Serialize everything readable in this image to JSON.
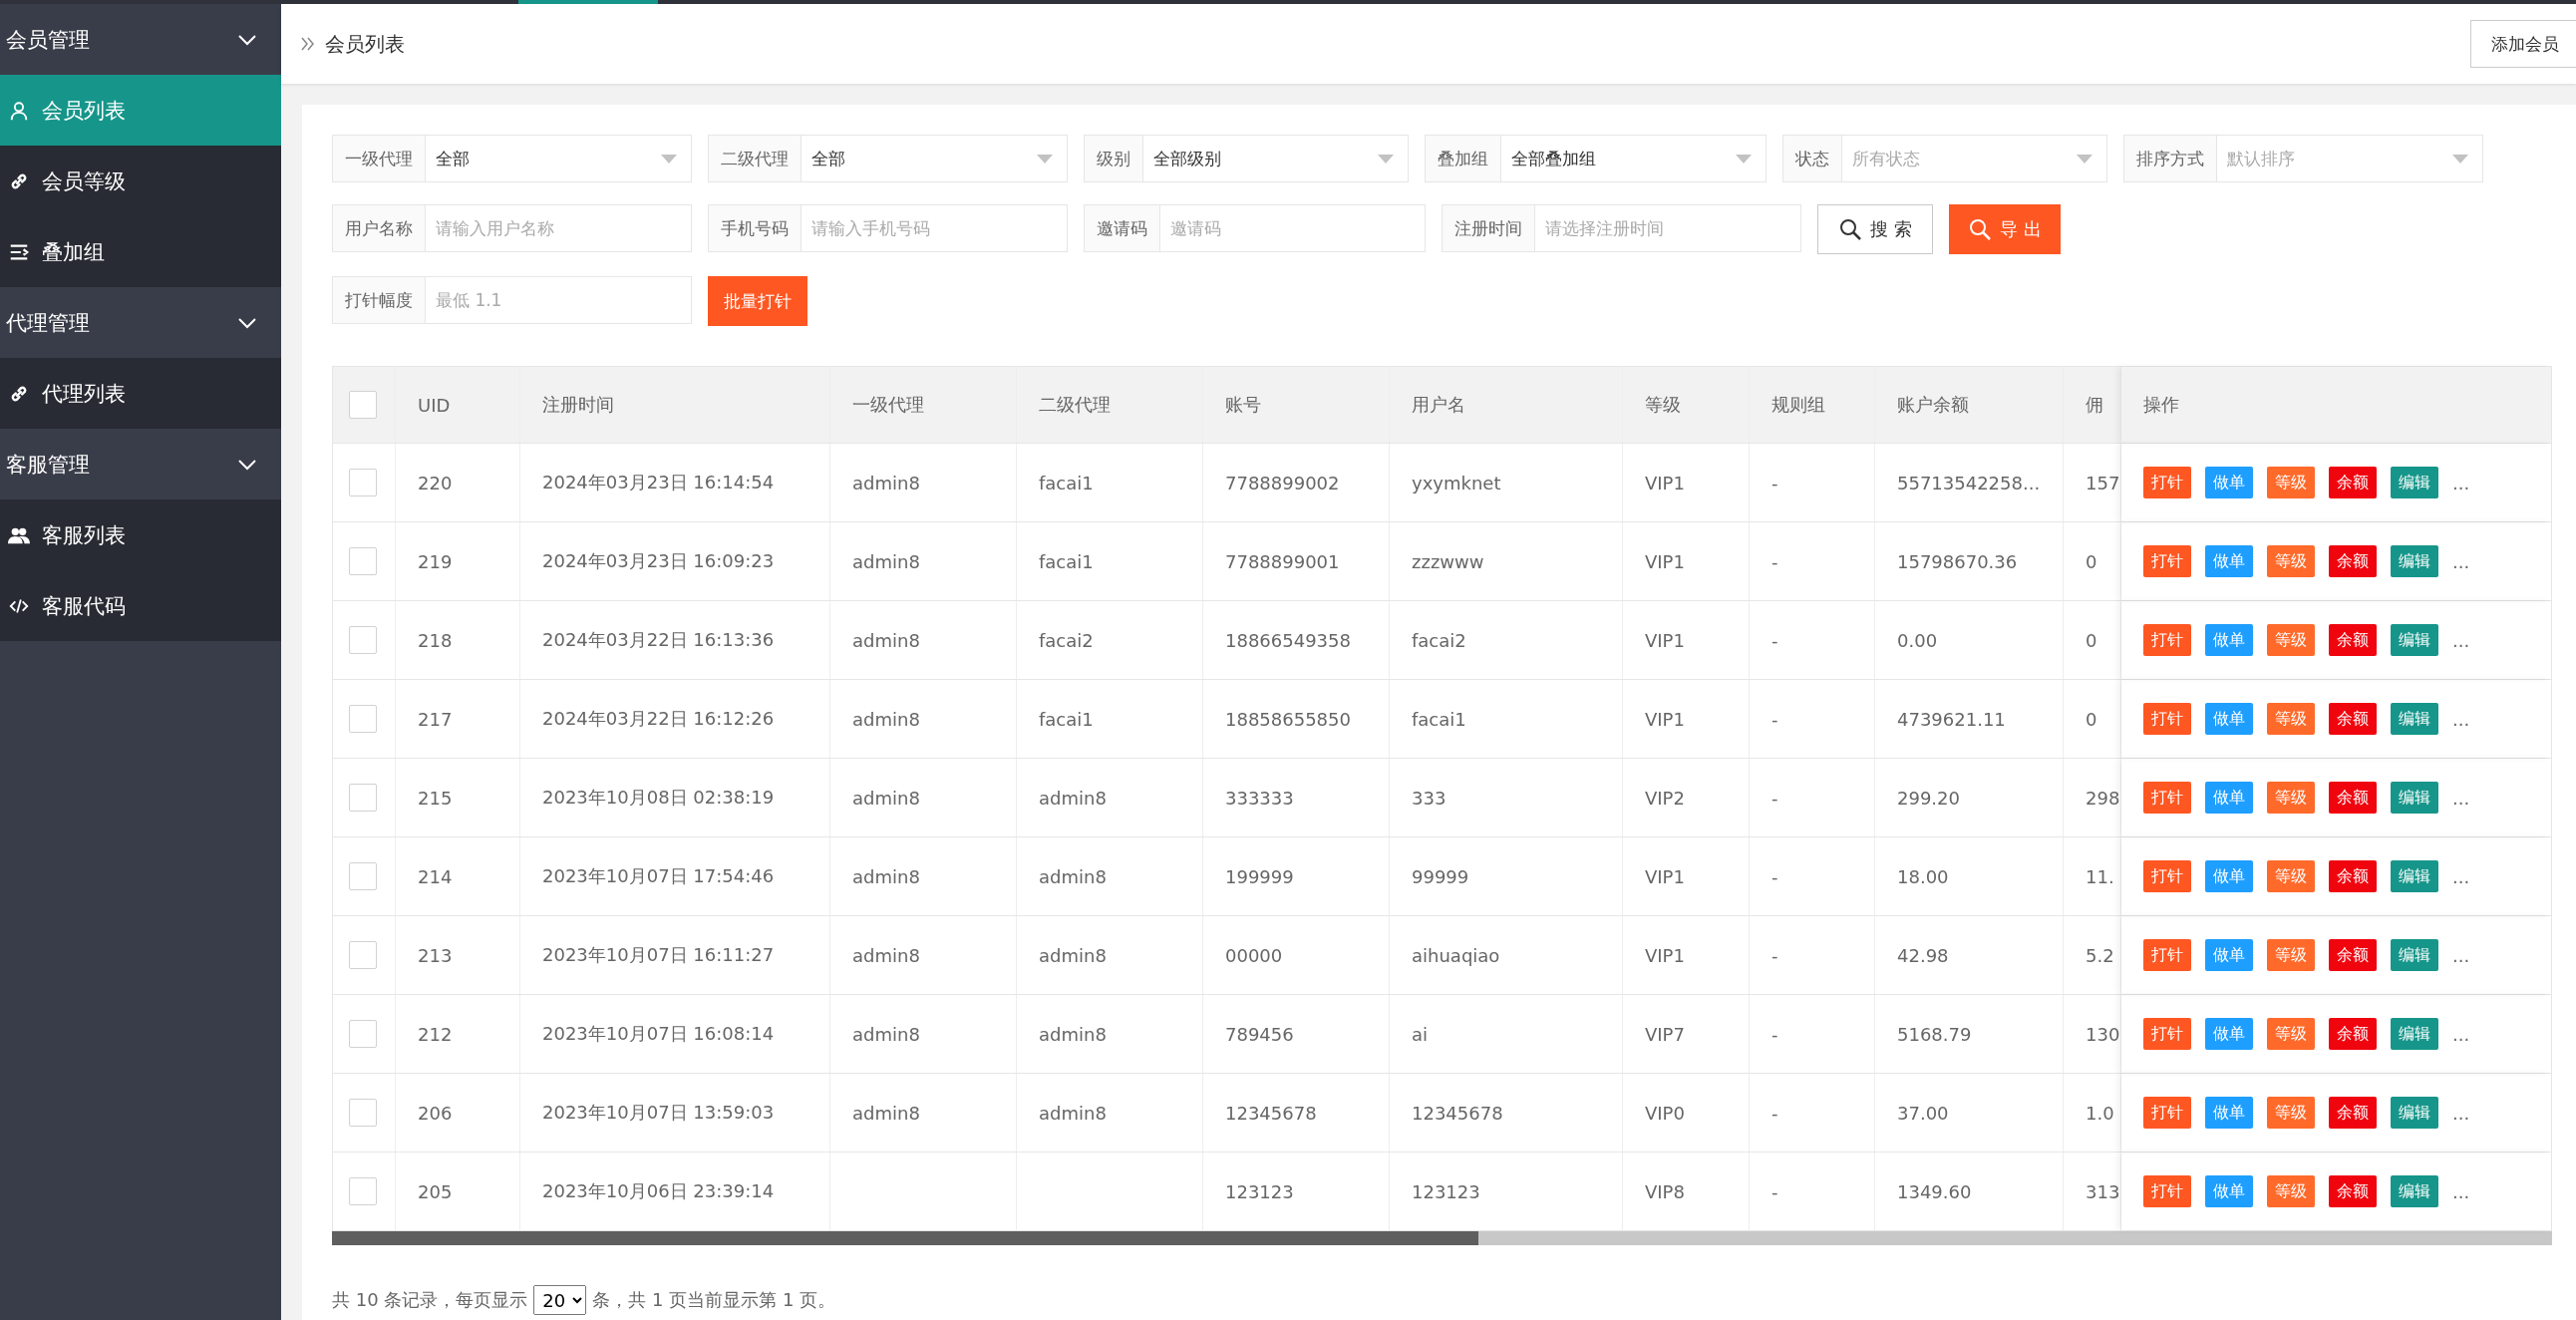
{
  "sidebar": {
    "groups": [
      {
        "label": "会员管理",
        "expanded": true,
        "items": [
          {
            "label": "会员列表",
            "selected": true
          },
          {
            "label": "会员等级",
            "selected": false
          },
          {
            "label": "叠加组",
            "selected": false
          }
        ]
      },
      {
        "label": "代理管理",
        "expanded": true,
        "items": [
          {
            "label": "代理列表",
            "selected": false
          }
        ]
      },
      {
        "label": "客服管理",
        "expanded": true,
        "items": [
          {
            "label": "客服列表",
            "selected": false
          },
          {
            "label": "客服代码",
            "selected": false
          }
        ]
      }
    ]
  },
  "header": {
    "breadcrumb": "会员列表",
    "add_button": "添加会员"
  },
  "filters": {
    "rows": [
      [
        {
          "kind": "select",
          "label": "一级代理",
          "value": "全部"
        },
        {
          "kind": "select",
          "label": "二级代理",
          "value": "全部"
        },
        {
          "kind": "select",
          "label": "级别",
          "value": "全部级别"
        },
        {
          "kind": "select",
          "label": "叠加组",
          "value": "全部叠加组"
        },
        {
          "kind": "select",
          "label": "状态",
          "placeholder": "所有状态"
        },
        {
          "kind": "select",
          "label": "排序方式",
          "placeholder": "默认排序"
        }
      ],
      [
        {
          "kind": "input",
          "label": "用户名称",
          "placeholder": "请输入用户名称"
        },
        {
          "kind": "input",
          "label": "手机号码",
          "placeholder": "请输入手机号码"
        },
        {
          "kind": "input",
          "label": "邀请码",
          "placeholder": "邀请码"
        },
        {
          "kind": "input",
          "label": "注册时间",
          "placeholder": "请选择注册时间"
        },
        {
          "kind": "search",
          "label": "搜 索"
        },
        {
          "kind": "export",
          "label": "导 出"
        }
      ],
      [
        {
          "kind": "input",
          "label": "打针幅度",
          "placeholder": "最低 1.1"
        },
        {
          "kind": "batch",
          "label": "批量打针"
        }
      ]
    ]
  },
  "table": {
    "header_checkbox": {
      "checked": false
    },
    "columns": [
      "UID",
      "注册时间",
      "一级代理",
      "二级代理",
      "账号",
      "用户名",
      "等级",
      "规则组",
      "账户余额",
      "佣",
      "操作"
    ],
    "rows": [
      {
        "checked": false,
        "cells": [
          "220",
          "2024年03月23日 16:14:54",
          "admin8",
          "facai1",
          "7788899002",
          "yxymknet",
          "VIP1",
          "-",
          "55713542258...",
          "157"
        ],
        "actions": [
          {
            "label": "打针",
            "color": "#ff5722"
          },
          {
            "label": "做单",
            "color": "#1e9fff"
          },
          {
            "label": "等级",
            "color": "#ff6a2b"
          },
          {
            "label": "余额",
            "color": "#f0050f"
          },
          {
            "label": "编辑",
            "color": "#16968a"
          }
        ],
        "more": "..."
      },
      {
        "checked": false,
        "cells": [
          "219",
          "2024年03月23日 16:09:23",
          "admin8",
          "facai1",
          "7788899001",
          "zzzwww",
          "VIP1",
          "-",
          "15798670.36",
          "0"
        ],
        "actions": [
          {
            "label": "打针",
            "color": "#ff5722"
          },
          {
            "label": "做单",
            "color": "#1e9fff"
          },
          {
            "label": "等级",
            "color": "#ff6a2b"
          },
          {
            "label": "余额",
            "color": "#f0050f"
          },
          {
            "label": "编辑",
            "color": "#16968a"
          }
        ],
        "more": "..."
      },
      {
        "checked": false,
        "cells": [
          "218",
          "2024年03月22日 16:13:36",
          "admin8",
          "facai2",
          "18866549358",
          "facai2",
          "VIP1",
          "-",
          "0.00",
          "0"
        ],
        "actions": [
          {
            "label": "打针",
            "color": "#ff5722"
          },
          {
            "label": "做单",
            "color": "#1e9fff"
          },
          {
            "label": "等级",
            "color": "#ff6a2b"
          },
          {
            "label": "余额",
            "color": "#f0050f"
          },
          {
            "label": "编辑",
            "color": "#16968a"
          }
        ],
        "more": "..."
      },
      {
        "checked": false,
        "cells": [
          "217",
          "2024年03月22日 16:12:26",
          "admin8",
          "facai1",
          "18858655850",
          "facai1",
          "VIP1",
          "-",
          "4739621.11",
          "0"
        ],
        "actions": [
          {
            "label": "打针",
            "color": "#ff5722"
          },
          {
            "label": "做单",
            "color": "#1e9fff"
          },
          {
            "label": "等级",
            "color": "#ff6a2b"
          },
          {
            "label": "余额",
            "color": "#f0050f"
          },
          {
            "label": "编辑",
            "color": "#16968a"
          }
        ],
        "more": "..."
      },
      {
        "checked": false,
        "cells": [
          "215",
          "2023年10月08日 02:38:19",
          "admin8",
          "admin8",
          "333333",
          "333",
          "VIP2",
          "-",
          "299.20",
          "298"
        ],
        "actions": [
          {
            "label": "打针",
            "color": "#ff5722"
          },
          {
            "label": "做单",
            "color": "#1e9fff"
          },
          {
            "label": "等级",
            "color": "#ff6a2b"
          },
          {
            "label": "余额",
            "color": "#f0050f"
          },
          {
            "label": "编辑",
            "color": "#16968a"
          }
        ],
        "more": "..."
      },
      {
        "checked": false,
        "cells": [
          "214",
          "2023年10月07日 17:54:46",
          "admin8",
          "admin8",
          "199999",
          "99999",
          "VIP1",
          "-",
          "18.00",
          "11."
        ],
        "actions": [
          {
            "label": "打针",
            "color": "#ff5722"
          },
          {
            "label": "做单",
            "color": "#1e9fff"
          },
          {
            "label": "等级",
            "color": "#ff6a2b"
          },
          {
            "label": "余额",
            "color": "#f0050f"
          },
          {
            "label": "编辑",
            "color": "#16968a"
          }
        ],
        "more": "..."
      },
      {
        "checked": false,
        "cells": [
          "213",
          "2023年10月07日 16:11:27",
          "admin8",
          "admin8",
          "00000",
          "aihuaqiao",
          "VIP1",
          "-",
          "42.98",
          "5.2"
        ],
        "actions": [
          {
            "label": "打针",
            "color": "#ff5722"
          },
          {
            "label": "做单",
            "color": "#1e9fff"
          },
          {
            "label": "等级",
            "color": "#ff6a2b"
          },
          {
            "label": "余额",
            "color": "#f0050f"
          },
          {
            "label": "编辑",
            "color": "#16968a"
          }
        ],
        "more": "..."
      },
      {
        "checked": false,
        "cells": [
          "212",
          "2023年10月07日 16:08:14",
          "admin8",
          "admin8",
          "789456",
          "ai",
          "VIP7",
          "-",
          "5168.79",
          "130"
        ],
        "actions": [
          {
            "label": "打针",
            "color": "#ff5722"
          },
          {
            "label": "做单",
            "color": "#1e9fff"
          },
          {
            "label": "等级",
            "color": "#ff6a2b"
          },
          {
            "label": "余额",
            "color": "#f0050f"
          },
          {
            "label": "编辑",
            "color": "#16968a"
          }
        ],
        "more": "..."
      },
      {
        "checked": false,
        "cells": [
          "206",
          "2023年10月07日 13:59:03",
          "admin8",
          "admin8",
          "12345678",
          "12345678",
          "VIP0",
          "-",
          "37.00",
          "1.0"
        ],
        "actions": [
          {
            "label": "打针",
            "color": "#ff5722"
          },
          {
            "label": "做单",
            "color": "#1e9fff"
          },
          {
            "label": "等级",
            "color": "#ff6a2b"
          },
          {
            "label": "余额",
            "color": "#f0050f"
          },
          {
            "label": "编辑",
            "color": "#16968a"
          }
        ],
        "more": "..."
      },
      {
        "checked": false,
        "cells": [
          "205",
          "2023年10月06日 23:39:14",
          null,
          null,
          "123123",
          "123123",
          "VIP8",
          "-",
          "1349.60",
          "313"
        ],
        "actions": [
          {
            "label": "打针",
            "color": "#ff5722"
          },
          {
            "label": "做单",
            "color": "#1e9fff"
          },
          {
            "label": "等级",
            "color": "#ff6a2b"
          },
          {
            "label": "余额",
            "color": "#f0050f"
          },
          {
            "label": "编辑",
            "color": "#16968a"
          }
        ],
        "more": "..."
      }
    ]
  },
  "pagination": {
    "text_before": "共 10 条记录，每页显示",
    "page_size": "20",
    "text_after": "条，共 1 页当前显示第 1 页。"
  }
}
